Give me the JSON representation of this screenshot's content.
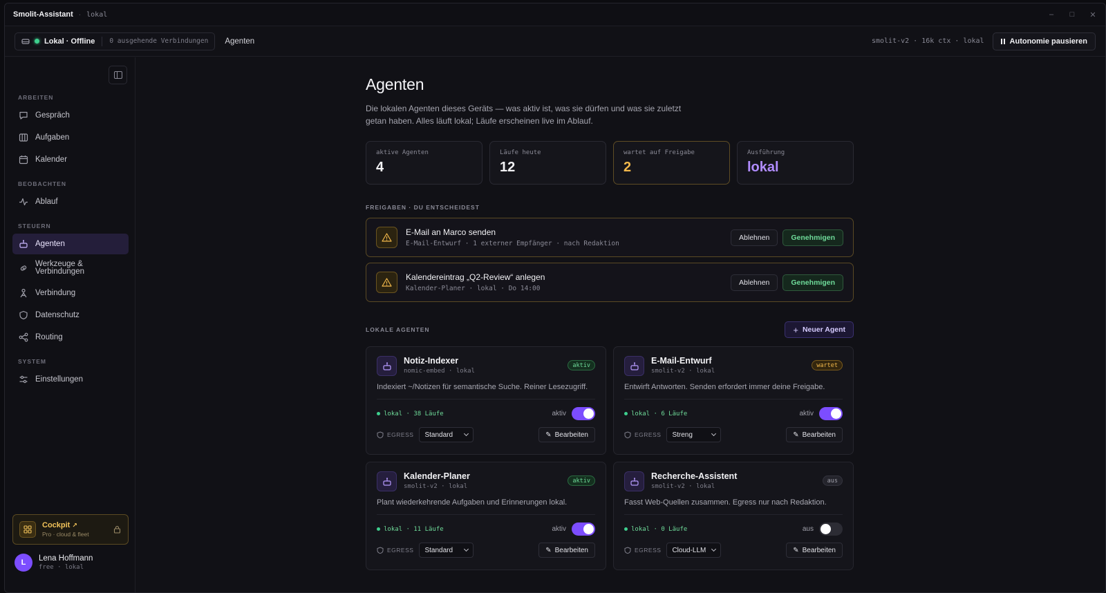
{
  "window": {
    "app_name": "Smolit-Assistant",
    "subtitle": "lokal"
  },
  "topbar": {
    "connection_label": "Lokal · Offline",
    "connection_count": "0 ausgehende Verbindungen",
    "breadcrumb": "Agenten",
    "model_info": "smolit-v2 · 16k ctx · lokal",
    "pause_label": "Autonomie pausieren"
  },
  "sidebar": {
    "sections": [
      "ARBEITEN",
      "BEOBACHTEN",
      "STEUERN",
      "SYSTEM"
    ],
    "items": [
      {
        "label": "Gespräch",
        "icon": "chat-icon"
      },
      {
        "label": "Aufgaben",
        "icon": "board-icon"
      },
      {
        "label": "Kalender",
        "icon": "calendar-icon"
      },
      {
        "label": "Ablauf",
        "icon": "activity-icon"
      },
      {
        "label": "Agenten",
        "icon": "robot-icon",
        "active": true
      },
      {
        "label": "Werkzeuge &",
        "label2": "Verbindungen",
        "icon": "link-icon"
      },
      {
        "label": "Verbindung",
        "icon": "person-icon"
      },
      {
        "label": "Datenschutz",
        "icon": "shield-icon"
      },
      {
        "label": "Routing",
        "icon": "share-icon"
      },
      {
        "label": "Einstellungen",
        "icon": "sliders-icon"
      }
    ],
    "cockpit": {
      "title": "Cockpit",
      "subtitle": "Pro · cloud & fleet"
    },
    "user": {
      "initial": "L",
      "name": "Lena Hoffmann",
      "plan": "free · lokal"
    }
  },
  "main": {
    "title": "Agenten",
    "lead": "Die lokalen Agenten dieses Geräts — was aktiv ist, was sie dürfen und was sie zuletzt getan haben. Alles läuft lokal; Läufe erscheinen live im Ablauf.",
    "stats": [
      {
        "label": "aktive Agenten",
        "value": "4"
      },
      {
        "label": "Läufe heute",
        "value": "12"
      },
      {
        "label": "wartet auf Freigabe",
        "value": "2"
      },
      {
        "label": "Ausführung",
        "value": "lokal"
      }
    ],
    "approvals_heading": "FREIGABEN · DU ENTSCHEIDEST",
    "approvals": [
      {
        "title": "E-Mail an Marco senden",
        "meta": "E-Mail-Entwurf · 1 externer Empfänger · nach Redaktion",
        "reject": "Ablehnen",
        "approve": "Genehmigen"
      },
      {
        "title": "Kalendereintrag „Q2-Review“ anlegen",
        "meta": "Kalender-Planer · lokal · Do 14:00",
        "reject": "Ablehnen",
        "approve": "Genehmigen"
      }
    ],
    "agents_heading": "LOKALE AGENTEN",
    "new_agent_label": "Neuer Agent",
    "agents": [
      {
        "name": "Notiz-Indexer",
        "model": "nomic-embed · lokal",
        "badge": "aktiv",
        "desc": "Indexiert ~/Notizen für semantische Suche. Reiner Lesezugriff.",
        "runs": "lokal · 38 Läufe",
        "toggle_label": "aktiv",
        "on": true,
        "egress_label": "EGRESS",
        "egress": "Standard",
        "edit": "Bearbeiten"
      },
      {
        "name": "E-Mail-Entwurf",
        "model": "smolit-v2 · lokal",
        "badge": "wartet",
        "desc": "Entwirft Antworten. Senden erfordert immer deine Freigabe.",
        "runs": "lokal · 6 Läufe",
        "toggle_label": "aktiv",
        "on": true,
        "egress_label": "EGRESS",
        "egress": "Streng",
        "edit": "Bearbeiten"
      },
      {
        "name": "Kalender-Planer",
        "model": "smolit-v2 · lokal",
        "badge": "aktiv",
        "desc": "Plant wiederkehrende Aufgaben und Erinnerungen lokal.",
        "runs": "lokal · 11 Läufe",
        "toggle_label": "aktiv",
        "on": true,
        "egress_label": "EGRESS",
        "egress": "Standard",
        "edit": "Bearbeiten"
      },
      {
        "name": "Recherche-Assistent",
        "model": "smolit-v2 · lokal",
        "badge": "aus",
        "desc": "Fasst Web-Quellen zusammen. Egress nur nach Redaktion.",
        "runs": "lokal · 0 Läufe",
        "toggle_label": "aus",
        "on": false,
        "egress_label": "EGRESS",
        "egress": "Cloud-LLM",
        "edit": "Bearbeiten"
      }
    ]
  }
}
